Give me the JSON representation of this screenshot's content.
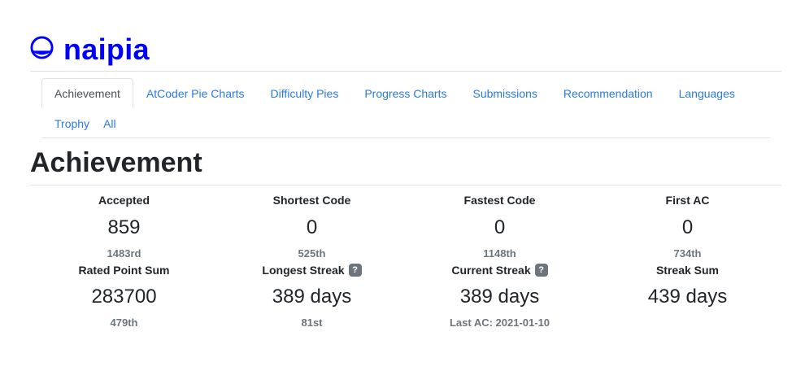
{
  "user": {
    "name": "naipia",
    "icon": "user-circle-icon"
  },
  "tabs": [
    {
      "label": "Achievement",
      "active": true
    },
    {
      "label": "AtCoder Pie Charts"
    },
    {
      "label": "Difficulty Pies"
    },
    {
      "label": "Progress Charts"
    },
    {
      "label": "Submissions"
    },
    {
      "label": "Recommendation"
    },
    {
      "label": "Languages"
    },
    {
      "label": "Trophy"
    },
    {
      "label": "All"
    }
  ],
  "section": {
    "title": "Achievement"
  },
  "stats": [
    {
      "label": "Accepted",
      "value": "859",
      "rank": "1483rd"
    },
    {
      "label": "Shortest Code",
      "value": "0",
      "rank": "525th"
    },
    {
      "label": "Fastest Code",
      "value": "0",
      "rank": "1148th"
    },
    {
      "label": "First AC",
      "value": "0",
      "rank": "734th"
    },
    {
      "label": "Rated Point Sum",
      "value": "283700",
      "rank": "479th"
    },
    {
      "label": "Longest Streak",
      "value": "389 days",
      "rank": "81st",
      "help": "?"
    },
    {
      "label": "Current Streak",
      "value": "389 days",
      "rank": "Last AC: 2021-01-10",
      "help": "?"
    },
    {
      "label": "Streak Sum",
      "value": "439 days",
      "rank": ""
    }
  ],
  "colors": {
    "brand": "#0000ff",
    "link": "#2a7ae2",
    "muted": "#6c757d",
    "text": "#212529"
  }
}
